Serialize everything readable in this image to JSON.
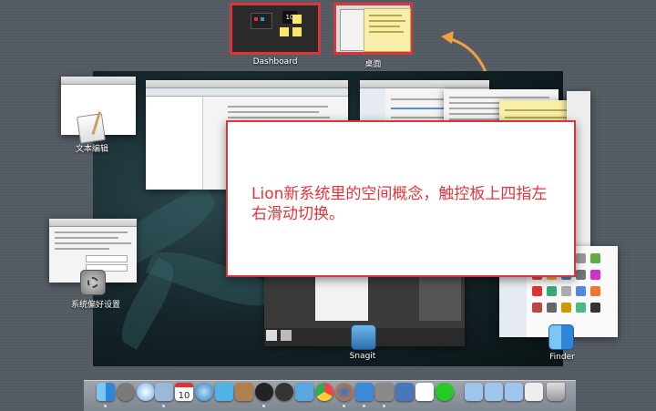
{
  "spaces": {
    "dashboard_label": "Dashboard",
    "desktop_label": "桌面"
  },
  "apps": {
    "text_edit_label": "文本编辑",
    "system_prefs_label": "系统偏好设置",
    "snagit_label": "Snagit",
    "finder_label": "Finder"
  },
  "callout": {
    "text": "Lion新系统里的空间概念，触控板上四指左右滑动切换。"
  },
  "dashboard_widget": {
    "clock_number": "10"
  },
  "colors": {
    "highlight": "#d8363a",
    "arrow": "#f0a040",
    "background": "#545b63"
  },
  "dock": {
    "icons": [
      "finder-icon",
      "launchpad-icon",
      "safari-icon",
      "mail-icon",
      "calendar-icon",
      "itunes-icon",
      "preview-icon",
      "notes-icon",
      "qq-icon",
      "qq-icon",
      "xcode-icon",
      "chrome-icon",
      "firefox-icon",
      "snagit-icon",
      "system-prefs-icon",
      "wifi-icon",
      "app-icon",
      "folder-icon",
      "folder-icon",
      "trash-icon"
    ],
    "calendar_day": "10"
  }
}
